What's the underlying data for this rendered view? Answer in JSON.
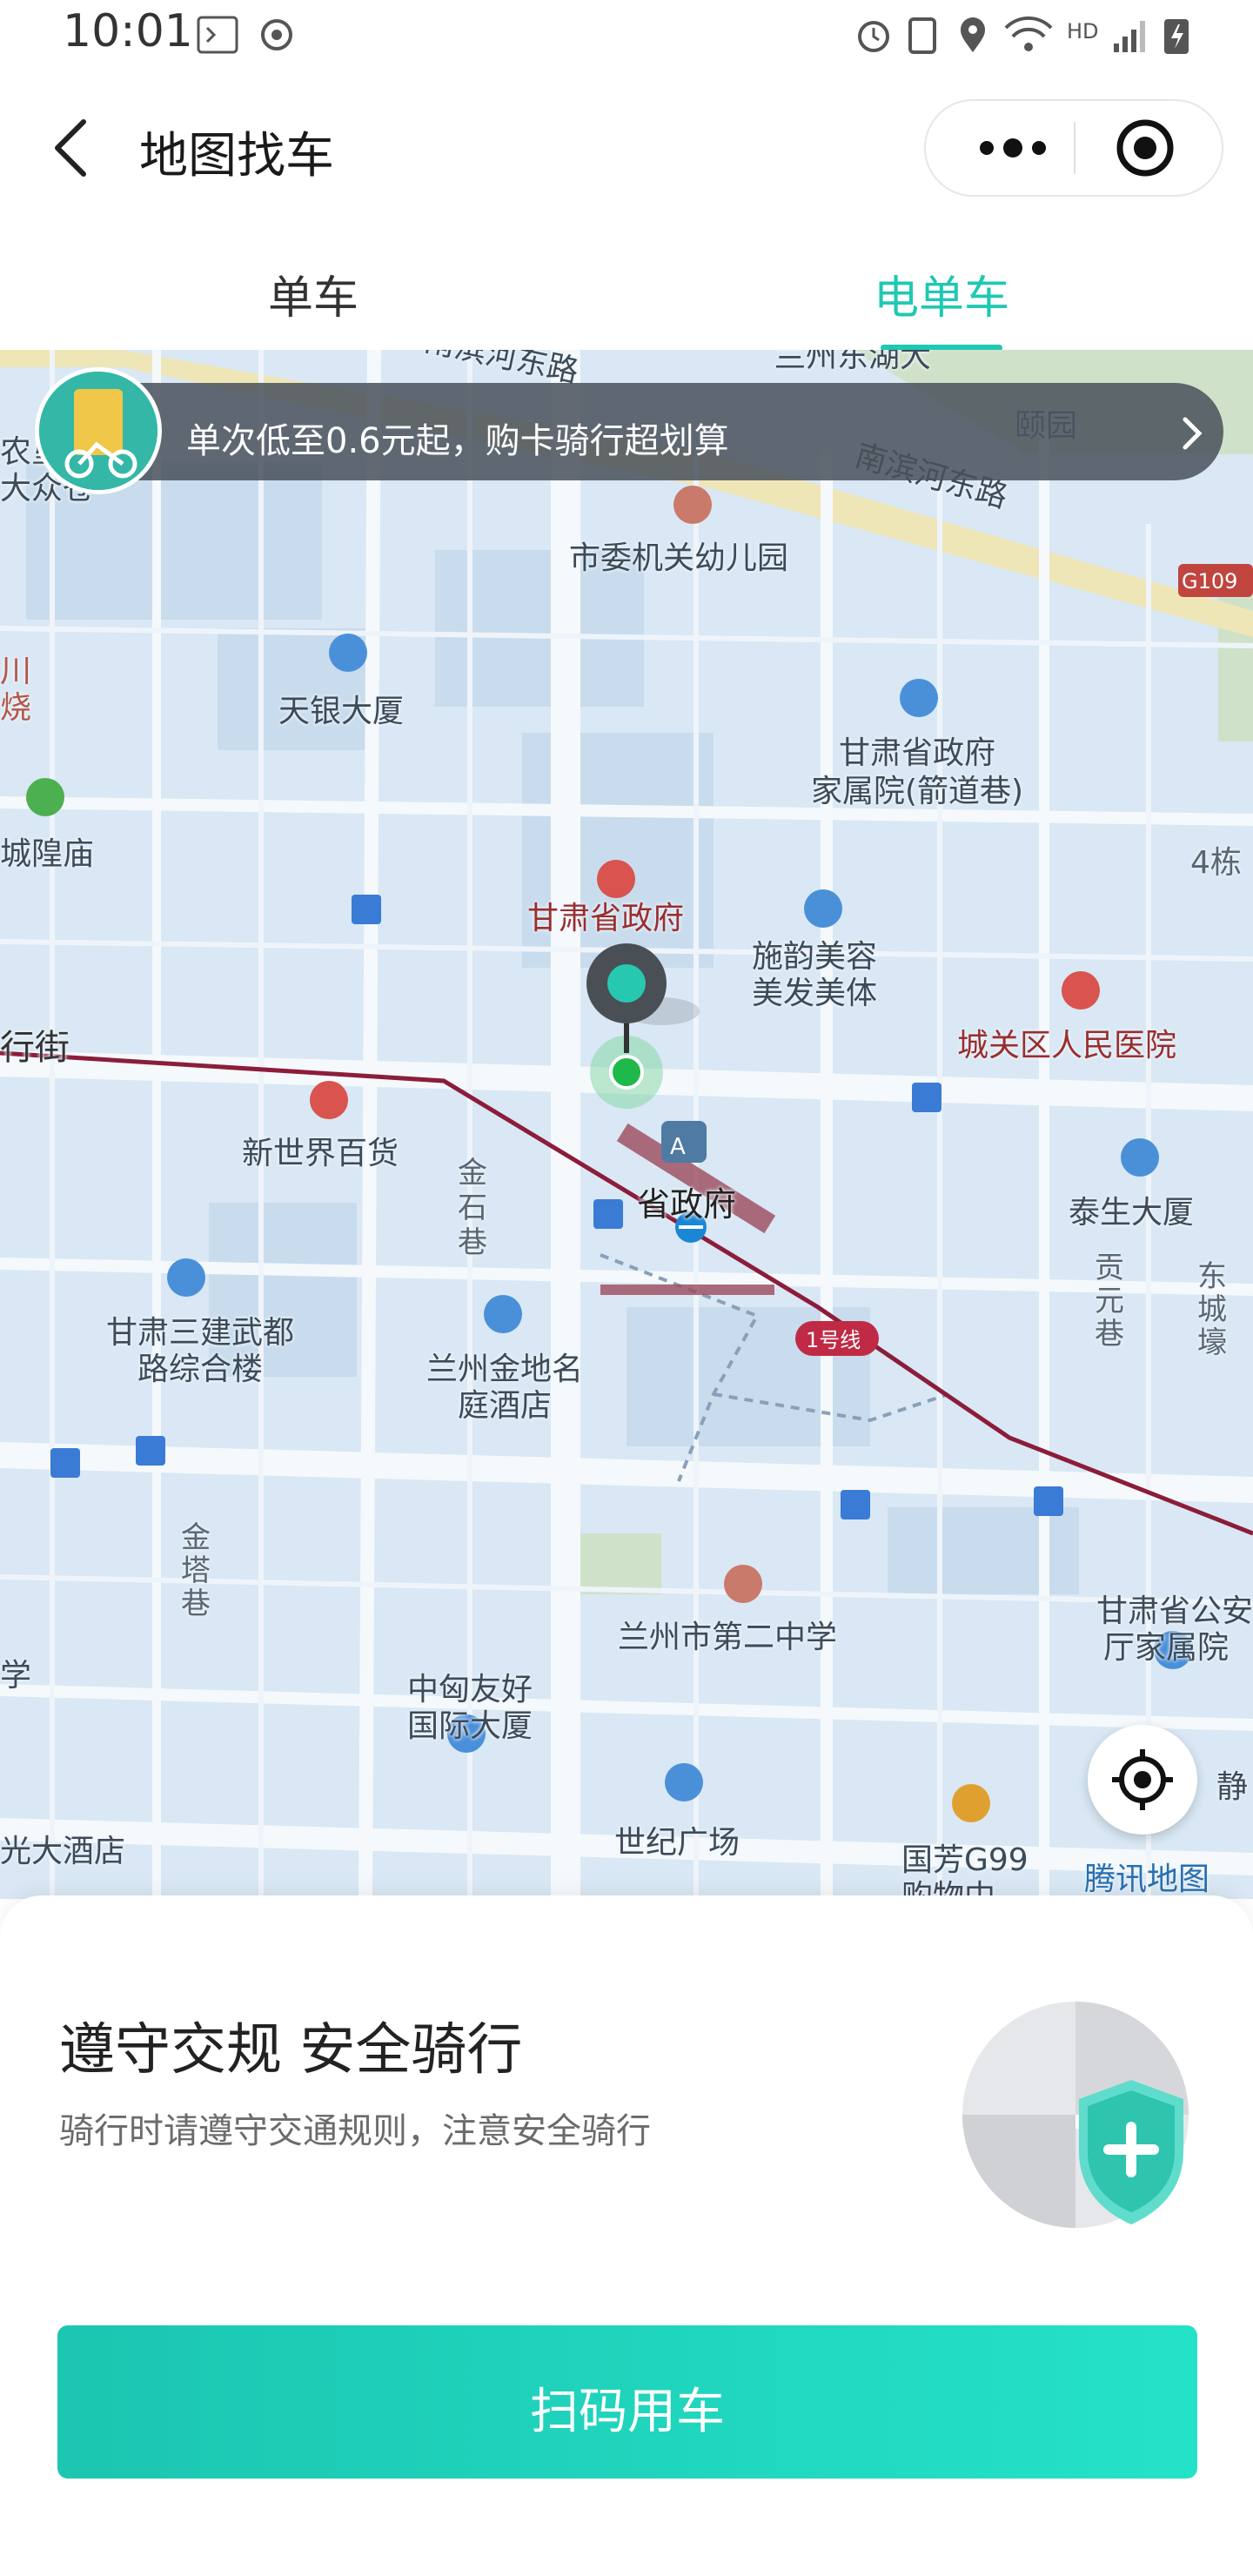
{
  "status_bar": {
    "time": "10:01",
    "network_label": "HD"
  },
  "header": {
    "title": "地图找车"
  },
  "tabs": [
    {
      "label": "单车",
      "active": false
    },
    {
      "label": "电单车",
      "active": true
    }
  ],
  "promo": {
    "text": "单次低至0.6元起，购卡骑行超划算"
  },
  "map": {
    "labels": {
      "nanbin_1": "南滨河东路",
      "nanbin_2": "南滨河东路",
      "yiyuan": "颐园",
      "g109": "G109",
      "shiwei": "市委机关幼儿园",
      "tianyin": "天银大厦",
      "gansu_gov_home_1": "甘肃省政府",
      "gansu_gov_home_2": "家属院(箭道巷)",
      "gansu_gov": "甘肃省政府",
      "shiyun_1": "施韵美容",
      "shiyun_2": "美发美体",
      "hospital": "城关区人民医院",
      "xinshijie": "新世界百货",
      "jinshi": "金石巷",
      "station": "省政府",
      "line1": "1号线",
      "taisheng": "泰生大厦",
      "gongyuan": "贡元巷",
      "dongcheng": "东城壕",
      "jianwu_1": "甘肃三建武都",
      "jianwu_2": "路综合楼",
      "jindi_1": "兰州金地名",
      "jindi_2": "庭酒店",
      "jinta": "金塔巷",
      "no2school": "兰州市第二中学",
      "gongan_1": "甘肃省公安",
      "gongan_2": "厅家属院",
      "zhongxiong_1": "中匈友好",
      "zhongxiong_2": "国际大厦",
      "shiji": "世纪广场",
      "guofang": "国芳G99",
      "guofang_2": "购物中",
      "tencent": "腾讯地图",
      "jing": "静",
      "xing_jie": "行街",
      "chenghuang": "城隍庙",
      "four": "4栋",
      "guang_hotel": "光大酒店",
      "metro_a": "A",
      "left_edge_1": "农垦",
      "left_edge_2": "大众苍",
      "left_edge_3": "川",
      "left_edge_4": "烧",
      "left_edge_5": "学",
      "top_cut": "兰州东湖大"
    }
  },
  "sheet": {
    "title": "遵守交规 安全骑行",
    "subtitle": "骑行时请遵守交通规则，注意安全骑行",
    "scan_button": "扫码用车"
  },
  "colors": {
    "accent": "#1fc8b3",
    "metro_line": "#8c1d3a",
    "map_bg": "#d9e8f4"
  }
}
